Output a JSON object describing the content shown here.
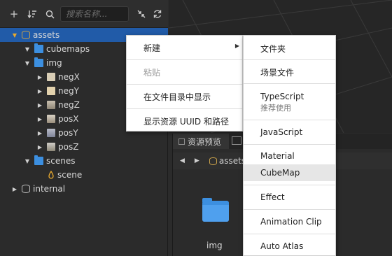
{
  "toolbar": {
    "add_icon": "plus-icon",
    "sort_icon": "sort-icon",
    "search_icon": "search-icon",
    "search_placeholder": "搜索名称...",
    "collapse_icon": "collapse-icon",
    "refresh_icon": "refresh-icon"
  },
  "tree": {
    "assets": "assets",
    "cubemaps": "cubemaps",
    "img": "img",
    "negX": "negX",
    "negY": "negY",
    "negZ": "negZ",
    "posX": "posX",
    "posY": "posY",
    "posZ": "posZ",
    "scenes": "scenes",
    "scene": "scene",
    "internal": "internal"
  },
  "preview": {
    "tab_label": "资源预览",
    "crumb": "assets",
    "folder_name": "img"
  },
  "context_menu": {
    "new": "新建",
    "paste": "粘贴",
    "show_in_explorer": "在文件目录中显示",
    "show_uuid": "显示资源 UUID 和路径"
  },
  "submenu": {
    "folder": "文件夹",
    "scene": "场景文件",
    "typescript": "TypeScript",
    "typescript_hint": "推荐使用",
    "javascript": "JavaScript",
    "material": "Material",
    "cubemap": "CubeMap",
    "effect": "Effect",
    "animation_clip": "Animation Clip",
    "auto_atlas": "Auto Atlas"
  },
  "colors": {
    "selection": "#215ba8",
    "folder": "#3c8fe0",
    "database": "#c9a14a"
  }
}
